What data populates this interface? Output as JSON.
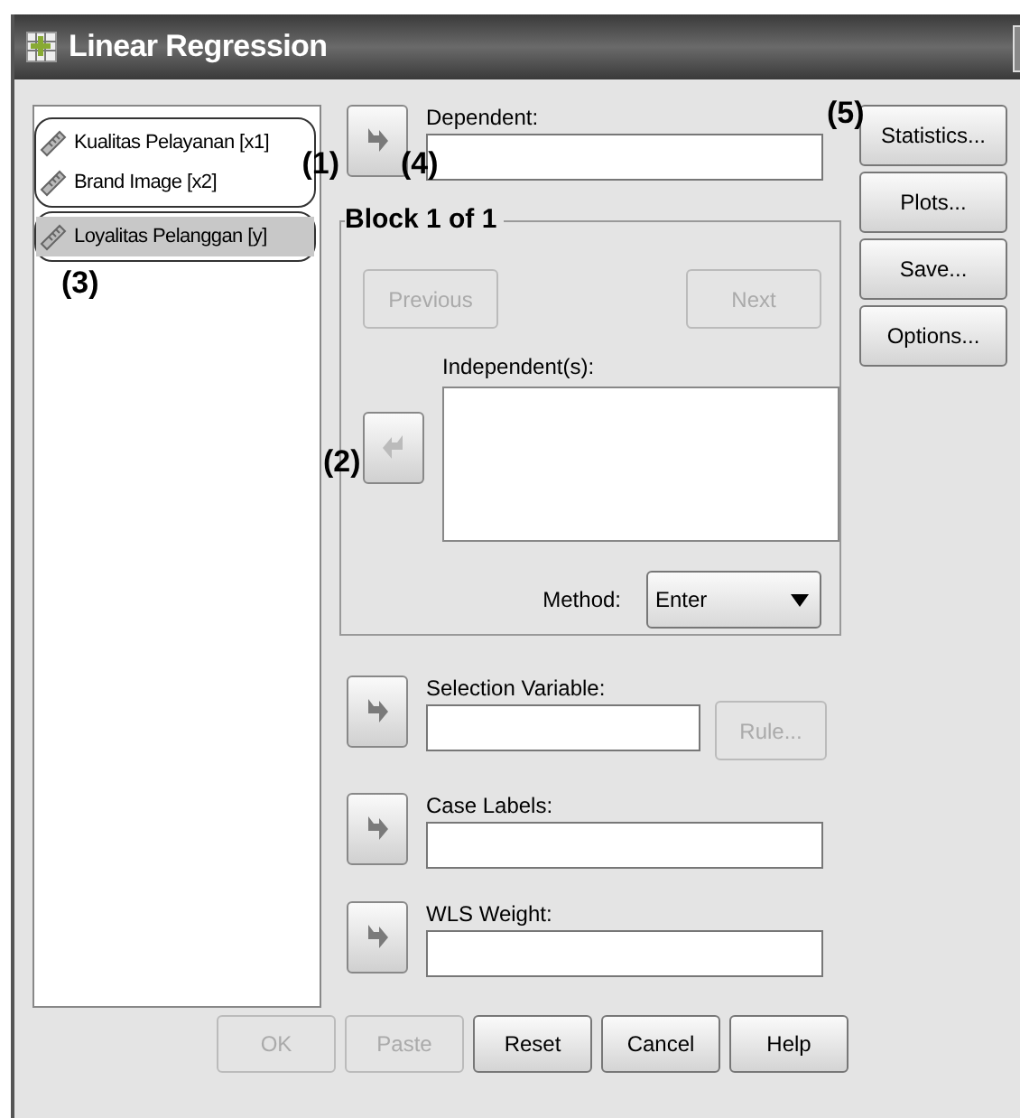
{
  "window": {
    "title": "Linear Regression"
  },
  "variables": {
    "groups": [
      {
        "annotation": "(1)",
        "items": [
          {
            "label": "Kualitas Pelayanan [x1]",
            "selected": false
          },
          {
            "label": "Brand Image [x2]",
            "selected": false
          }
        ]
      },
      {
        "annotation": "(3)",
        "items": [
          {
            "label": "Loyalitas Pelanggan [y]",
            "selected": true
          }
        ]
      }
    ]
  },
  "dependent": {
    "label": "Dependent:",
    "annotation": "(4)",
    "arrow_disabled": false
  },
  "block": {
    "title": "Block 1 of 1",
    "previous": {
      "label": "Previous",
      "disabled": true
    },
    "next": {
      "label": "Next",
      "disabled": true
    },
    "independent_label": "Independent(s):",
    "annotation": "(2)",
    "arrow_disabled": true,
    "method_label": "Method:",
    "method_value": "Enter"
  },
  "selection_variable": {
    "label": "Selection Variable:",
    "rule": {
      "label": "Rule...",
      "disabled": true
    }
  },
  "case_labels": {
    "label": "Case Labels:"
  },
  "wls_weight": {
    "label": "WLS Weight:"
  },
  "side_buttons": {
    "annotation": "(5)",
    "buttons": [
      {
        "label": "Statistics...",
        "disabled": false
      },
      {
        "label": "Plots...",
        "disabled": false
      },
      {
        "label": "Save...",
        "disabled": false
      },
      {
        "label": "Options...",
        "disabled": false
      }
    ]
  },
  "buttons": [
    {
      "label": "OK",
      "disabled": true
    },
    {
      "label": "Paste",
      "disabled": true
    },
    {
      "label": "Reset",
      "disabled": false
    },
    {
      "label": "Cancel",
      "disabled": false
    },
    {
      "label": "Help",
      "disabled": false
    }
  ]
}
